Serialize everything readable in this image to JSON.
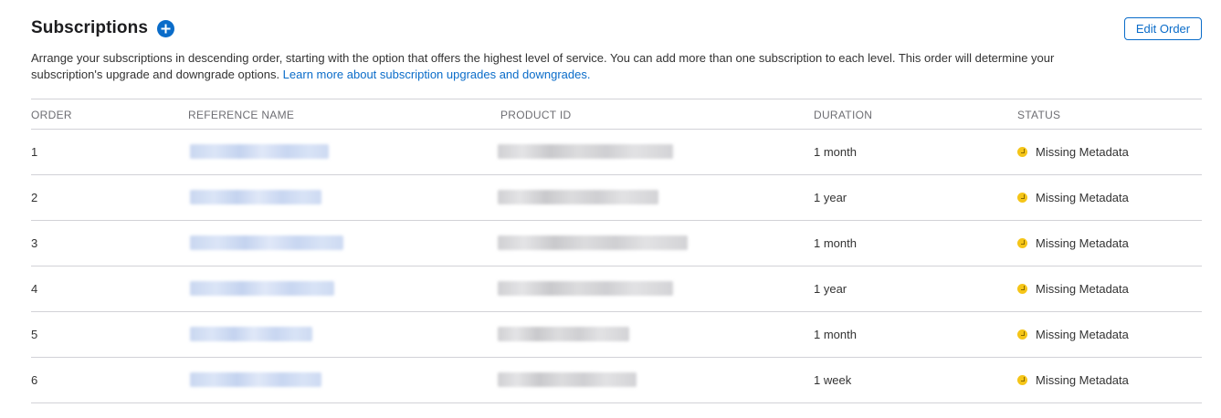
{
  "header": {
    "title": "Subscriptions",
    "add_icon": "plus-circle-icon",
    "edit_order_label": "Edit Order"
  },
  "description": {
    "text": "Arrange your subscriptions in descending order, starting with the option that offers the highest level of service. You can add more than one subscription to each level. This order will determine your subscription's upgrade and downgrade options. ",
    "link_text": "Learn more about subscription upgrades and downgrades."
  },
  "table": {
    "columns": [
      "ORDER",
      "REFERENCE NAME",
      "PRODUCT ID",
      "DURATION",
      "STATUS"
    ],
    "rows": [
      {
        "order": "1",
        "duration": "1 month",
        "status": "Missing Metadata"
      },
      {
        "order": "2",
        "duration": "1 year",
        "status": "Missing Metadata"
      },
      {
        "order": "3",
        "duration": "1 month",
        "status": "Missing Metadata"
      },
      {
        "order": "4",
        "duration": "1 year",
        "status": "Missing Metadata"
      },
      {
        "order": "5",
        "duration": "1 month",
        "status": "Missing Metadata"
      },
      {
        "order": "6",
        "duration": "1 week",
        "status": "Missing Metadata"
      }
    ]
  },
  "colors": {
    "accent": "#0a6cc9",
    "status_warning": "#f5c518",
    "divider": "#d2d2d7"
  }
}
